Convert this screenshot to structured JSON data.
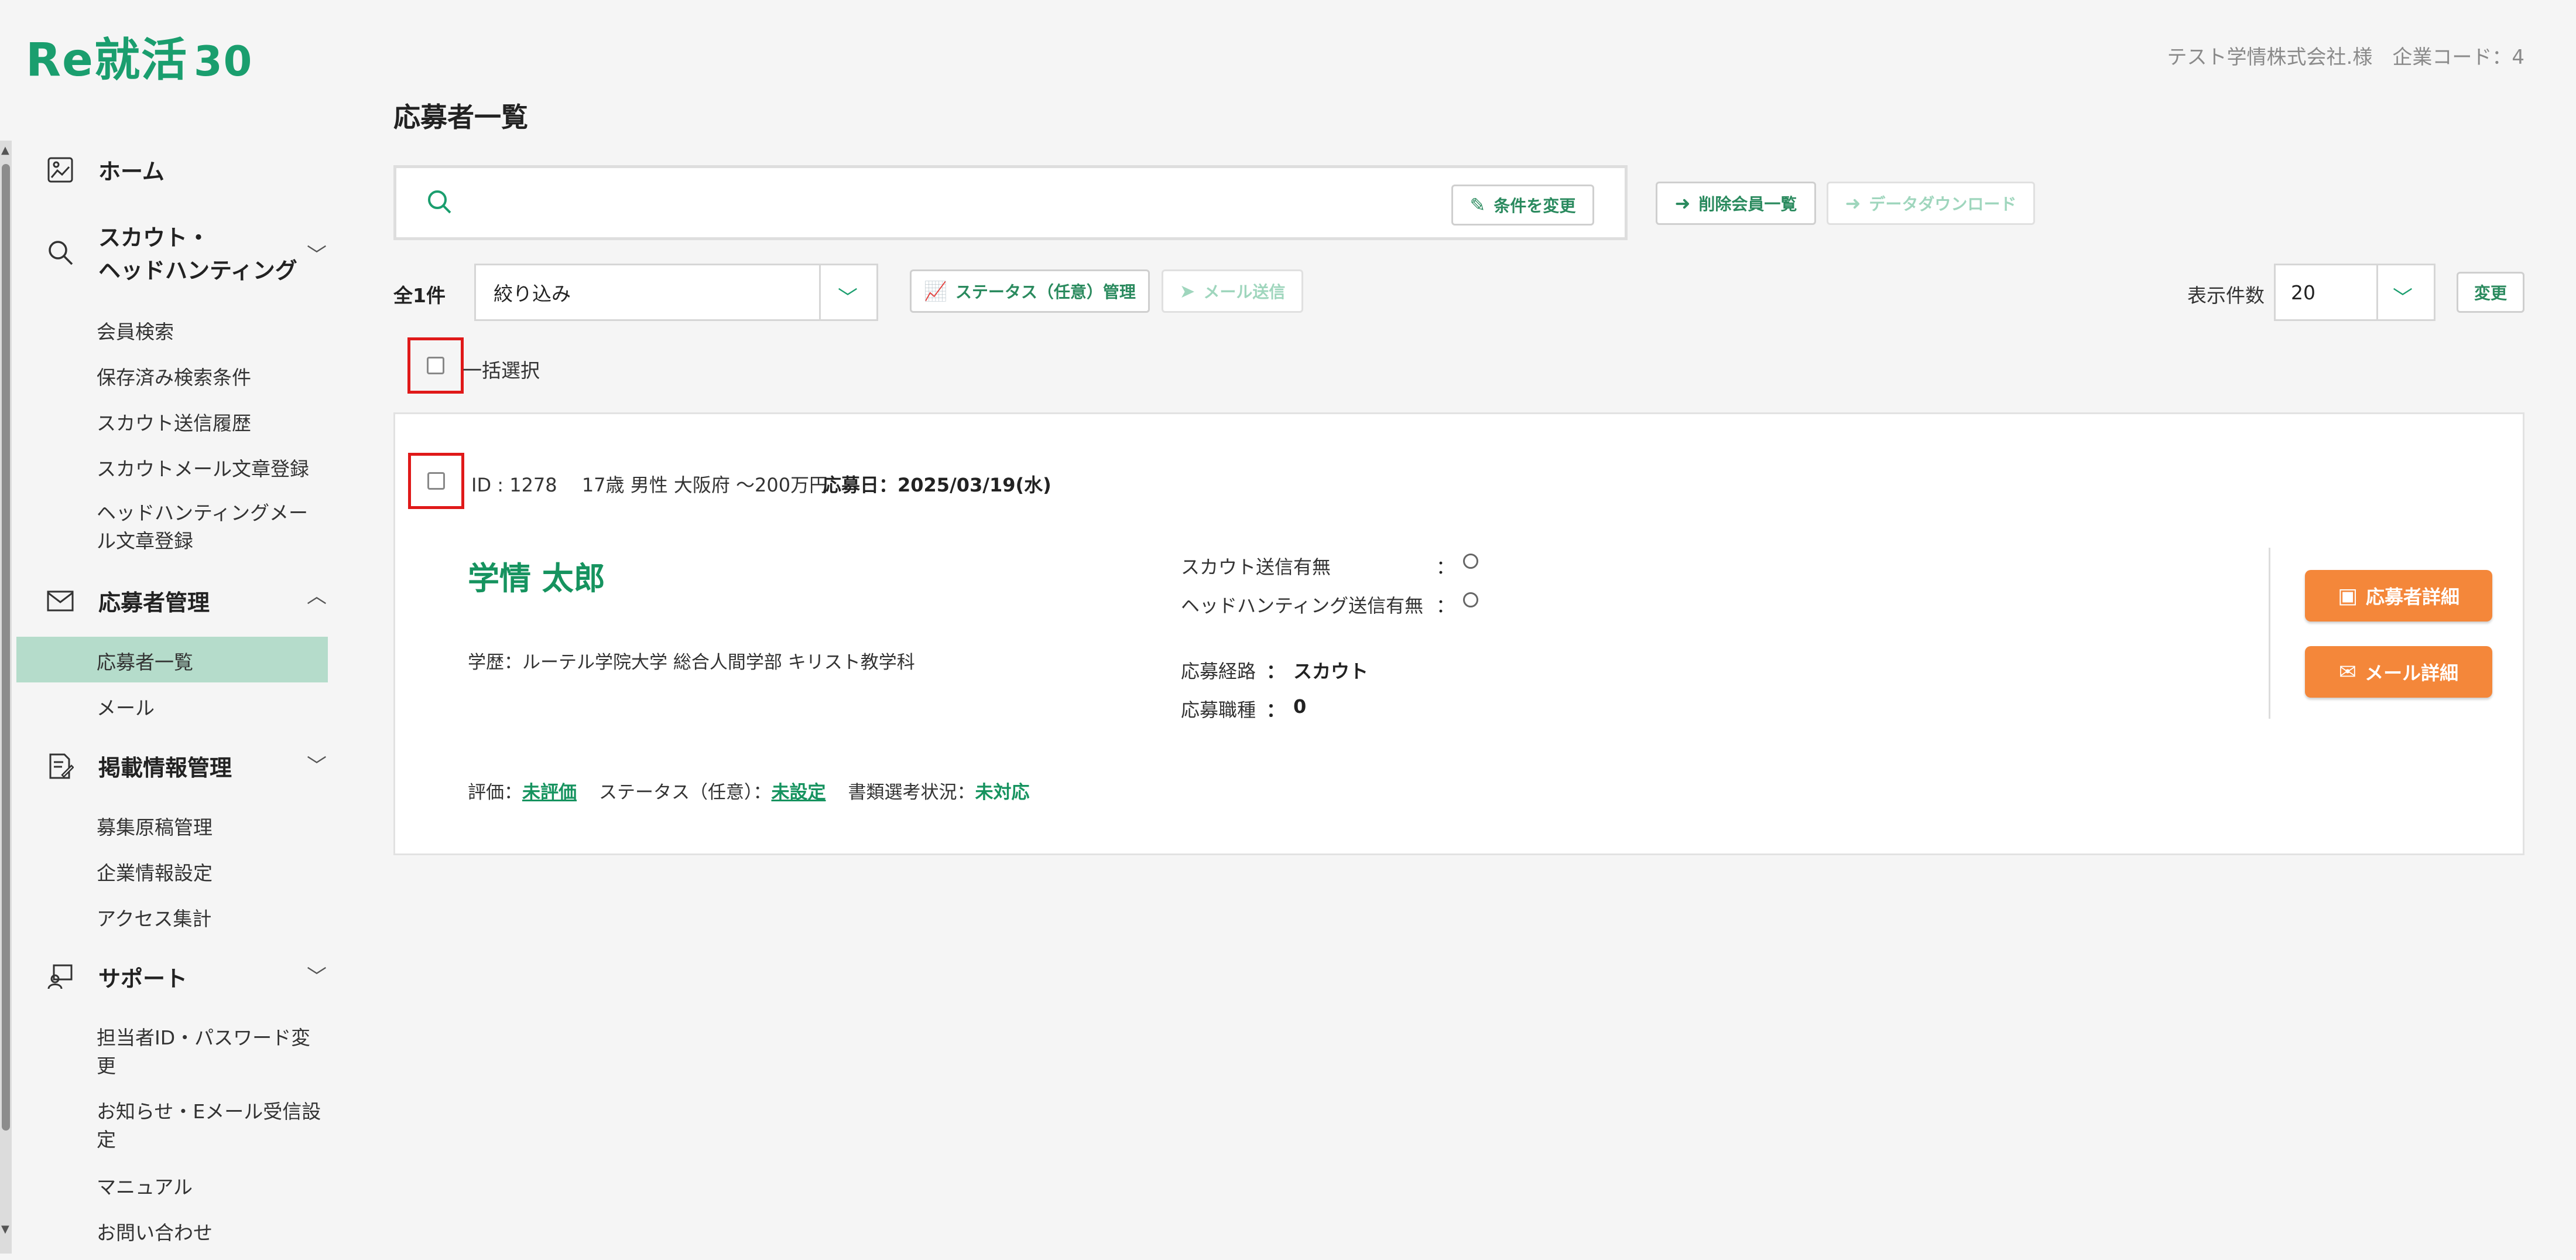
{
  "header": {
    "logo_text": "Re就活",
    "logo_num": "30",
    "company": "テスト学情株式会社.様　企業コード：4"
  },
  "sidebar": {
    "home": "ホーム",
    "scout": "スカウト・\nヘッドハンティング",
    "scout_items": [
      "会員検索",
      "保存済み検索条件",
      "スカウト送信履歴",
      "スカウトメール文章登録",
      "ヘッドハンティングメー\nル文章登録"
    ],
    "applicant": "応募者管理",
    "applicant_items": [
      "応募者一覧",
      "メール"
    ],
    "posting": "掲載情報管理",
    "posting_items": [
      "募集原稿管理",
      "企業情報設定",
      "アクセス集計"
    ],
    "support": "サポート",
    "support_items": [
      "担当者ID・パスワード変\n更",
      "お知らせ・Eメール受信設\n定",
      "マニュアル",
      "お問い合わせ"
    ]
  },
  "main": {
    "title": "応募者一覧",
    "change_conditions": "条件を変更",
    "deleted_members": "削除会員一覧",
    "data_download": "データダウンロード",
    "total": "全1件",
    "filter": "絞り込み",
    "status_manage": "ステータス（任意）管理",
    "send_mail": "メール送信",
    "display_count_label": "表示件数",
    "display_count": "20",
    "change": "変更",
    "select_all": "一括選択"
  },
  "applicant": {
    "meta": "ID : 1278　 17歳 男性 大阪府 ～200万円",
    "applied_date": "応募日：2025/03/19(水)",
    "name": "学情 太郎",
    "education": "学歴：ルーテル学院大学 総合人間学部 キリスト教学科",
    "scout_sent_label": "スカウト送信有無",
    "headhunting_sent_label": "ヘッドハンティング送信有無",
    "colon": "：",
    "route_label": "応募経路",
    "route_value": "スカウト",
    "job_label": "応募職種",
    "job_value": "0",
    "eval_label": "評価：",
    "eval_value": "未評価",
    "status_label": "ステータス（任意）：",
    "status_value": "未設定",
    "doc_label": "書類選考状況：",
    "doc_value": "未対応",
    "detail_button": "応募者詳細",
    "mail_button": "メール詳細"
  },
  "colors": {
    "brand": "#1a9e6e",
    "orange": "#f4873a",
    "active": "#b5dccb",
    "highlight": "#e01919"
  }
}
